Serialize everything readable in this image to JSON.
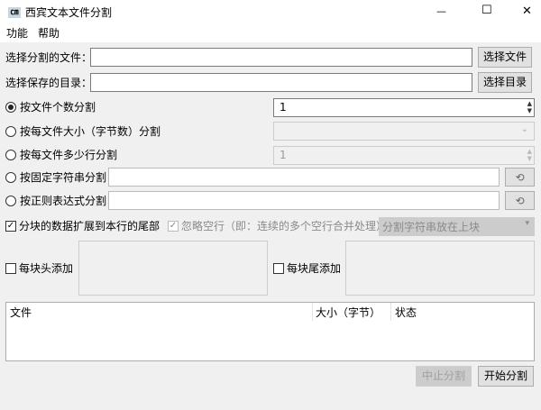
{
  "window": {
    "title": "西宾文本文件分割",
    "icon": "app-icon",
    "minimize": "—",
    "maximize": "☐",
    "close": "✕"
  },
  "menu": [
    "功能",
    "帮助"
  ],
  "file_row": {
    "label": "选择分割的文件：",
    "value": "",
    "button": "选择文件"
  },
  "dir_row": {
    "label": "选择保存的目录：",
    "value": "",
    "button": "选择目录"
  },
  "modes": [
    {
      "label": "按文件个数分割",
      "selected": true,
      "value": "1"
    },
    {
      "label": "按每文件大小（字节数）分割",
      "selected": false,
      "value": ""
    },
    {
      "label": "按每文件多少行分割",
      "selected": false,
      "value": "1"
    },
    {
      "label": "按固定字符串分割",
      "selected": false,
      "value": ""
    },
    {
      "label": "按正则表达式分割",
      "selected": false,
      "value": ""
    }
  ],
  "options": {
    "extend_label": "分块的数据扩展到本行的尾部",
    "extend_checked": true,
    "ignore_label": "忽略空行（即：连续的多个空行合并处理）",
    "ignore_checked": true,
    "position_select": "分割字符串放在上块"
  },
  "header_add": {
    "label": "每块头添加",
    "value": ""
  },
  "footer_add": {
    "label": "每块尾添加",
    "value": ""
  },
  "table": {
    "columns": [
      "文件",
      "大小（字节）",
      "状态"
    ],
    "rows": []
  },
  "buttons": {
    "stop": "中止分割",
    "start": "开始分割"
  }
}
